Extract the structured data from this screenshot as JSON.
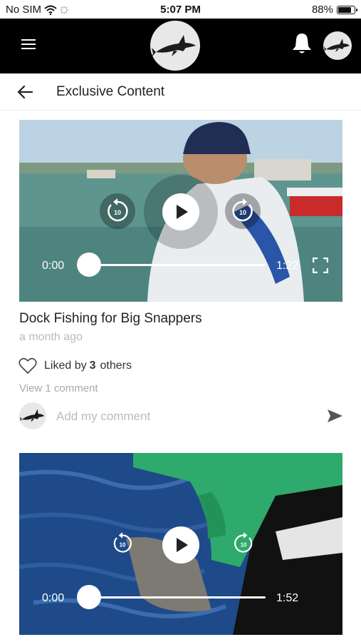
{
  "status_bar": {
    "carrier": "No SIM",
    "time": "5:07 PM",
    "battery": "88%",
    "battery_level": 0.88
  },
  "header": {
    "menu_icon": "hamburger-icon",
    "logo_icon": "shark-logo-icon",
    "notifications_icon": "bell-icon",
    "profile_icon": "shark-avatar-icon"
  },
  "nav": {
    "title": "Exclusive Content",
    "back_icon": "arrow-left-icon"
  },
  "videos": [
    {
      "current_time": "0:00",
      "duration": "1:22",
      "progress": 0,
      "title": "Dock Fishing for Big Snappers",
      "posted": "a month ago",
      "likes_prefix": "Liked by",
      "likes_count": "3",
      "likes_suffix": "others",
      "comments_link": "View 1 comment",
      "comment_placeholder": "Add my comment"
    },
    {
      "current_time": "0:00",
      "duration": "1:52",
      "progress": 0
    }
  ],
  "controls": {
    "rewind_label": "10",
    "forward_label": "10"
  },
  "colors": {
    "header_bg": "#000000",
    "accent": "#ffffff"
  }
}
